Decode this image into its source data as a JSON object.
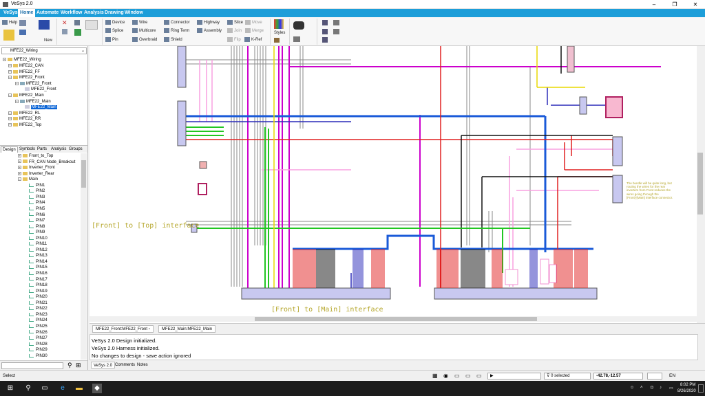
{
  "window": {
    "title": "VeSys 2.0",
    "minimize": "–",
    "maximize": "❐",
    "close": "✕"
  },
  "menu": [
    "VeSys",
    "Home",
    "Automate",
    "Workflow",
    "Analysis",
    "Drawing",
    "Window"
  ],
  "ribbon": {
    "help": "Help",
    "new": "New",
    "device": "Device",
    "splice": "Splice",
    "pin": "Pin",
    "wire": "Wire",
    "multicore": "Multicore",
    "overbraid": "Overbraid",
    "connector": "Connector",
    "ring_term": "Ring Term",
    "shield": "Shield",
    "highway": "Highway",
    "assembly": "Assembly",
    "flip": "Flip",
    "slice": "Slice",
    "join": "Join",
    "kref": "K-Ref",
    "move": "Move",
    "merge": "Merge",
    "styles": "Styles"
  },
  "left_pane": {
    "dropdown": "MFE22_Wiring",
    "tree": [
      {
        "label": "MFE22_Wiring",
        "indent": 0
      },
      {
        "label": "MFE22_CAN",
        "indent": 1
      },
      {
        "label": "MFE22_FF",
        "indent": 1
      },
      {
        "label": "MFE22_Front",
        "indent": 1
      },
      {
        "label": "MFE22_Front",
        "indent": 2
      },
      {
        "label": "MFE22_Front",
        "indent": 3
      },
      {
        "label": "MFE22_Main",
        "indent": 1
      },
      {
        "label": "MFE22_Main",
        "indent": 2
      },
      {
        "label": "MFE22_Main",
        "indent": 3,
        "selected": true
      },
      {
        "label": "MFE22_RL",
        "indent": 1
      },
      {
        "label": "MFE22_RR",
        "indent": 1
      },
      {
        "label": "MFE22_Top",
        "indent": 1
      }
    ],
    "tabs": [
      "Design",
      "Symbols",
      "Parts",
      "Analysis",
      "Groups"
    ],
    "design_tree": [
      {
        "label": "Front_to_Top",
        "indent": 1
      },
      {
        "label": "FR_CAN Node_Breakout",
        "indent": 1
      },
      {
        "label": "Inverter_Front",
        "indent": 1
      },
      {
        "label": "Inverter_Rear",
        "indent": 1
      },
      {
        "label": "Main",
        "indent": 1
      }
    ],
    "pins": [
      "PIN1",
      "PIN2",
      "PIN3",
      "PIN4",
      "PIN5",
      "PIN6",
      "PIN7",
      "PIN8",
      "PIN9",
      "PIN10",
      "PIN11",
      "PIN12",
      "PIN13",
      "PIN14",
      "PIN15",
      "PIN16",
      "PIN17",
      "PIN18",
      "PIN19",
      "PIN20",
      "PIN21",
      "PIN22",
      "PIN23",
      "PIN24",
      "PIN25",
      "PIN26",
      "PIN27",
      "PIN28",
      "PIN29",
      "PIN30"
    ]
  },
  "canvas": {
    "annotation_top": "[Front] to [Top] interface",
    "annotation_main": "[Front] to [Main] interface",
    "note_lines": [
      "The bundle will be quite long, but",
      "routing the wires for the rear",
      "inverters from Front reduces the",
      "wires going through the",
      "[Front]-[Main] interface connector."
    ]
  },
  "doc_tabs": [
    "MFE22_Front:MFE22_Front",
    "MFE22_Main:MFE22_Main"
  ],
  "output": {
    "lines": [
      "VeSys 2.0 Design initialized.",
      "VeSys 2.0 Harness initialized.",
      "No changes to design - save action ignored"
    ],
    "tabs": [
      "VeSys 2.0",
      "Comments",
      "Notes"
    ]
  },
  "status": {
    "left": "Select",
    "selected": "0 selected",
    "coords": "-42.78,-12.57",
    "lang": "EN"
  },
  "taskbar": {
    "time": "8:02 PM",
    "date": "8/26/2020"
  },
  "colors": {
    "accent": "#1d9ed9",
    "annotation": "#b5a62a",
    "connector": "#c8c8f0"
  }
}
